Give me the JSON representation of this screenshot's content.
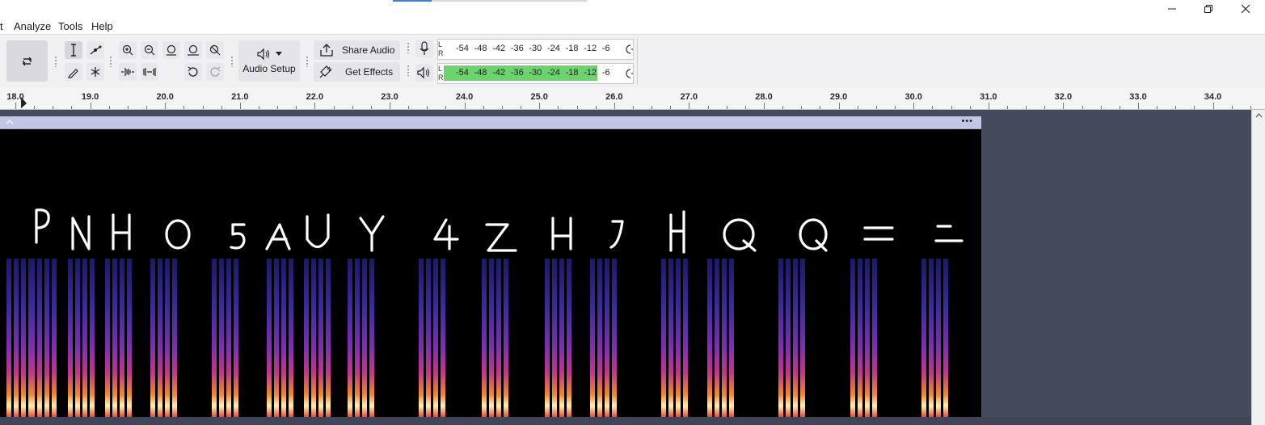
{
  "menu": {
    "items": [
      "t",
      "Analyze",
      "Tools",
      "Help"
    ]
  },
  "toolbar": {
    "audio_setup": "Audio Setup",
    "share_audio": "Share Audio",
    "get_effects": "Get Effects"
  },
  "meters": {
    "record_channel_labels": [
      "L",
      "R"
    ],
    "play_channel_labels": [
      "L",
      "R"
    ],
    "scale": [
      "-54",
      "-48",
      "-42",
      "-36",
      "-30",
      "-24",
      "-18",
      "-12",
      "-6"
    ],
    "playback_level_fraction": 0.79
  },
  "ruler": {
    "labels": [
      "18.0",
      "19.0",
      "20.0",
      "21.0",
      "22.0",
      "23.0",
      "24.0",
      "25.0",
      "26.0",
      "27.0",
      "28.0",
      "29.0",
      "30.0",
      "31.0",
      "32.0",
      "33.0",
      "34.0"
    ]
  },
  "track": {
    "menu_dots": "•••"
  },
  "colors": {
    "toolbar_bg": "#f1f1f3",
    "meter_green": "#6dd46d",
    "clip_header": "#c2c7e6",
    "track_bg": "#454a5c",
    "spectrogram_bg": "#000000"
  }
}
